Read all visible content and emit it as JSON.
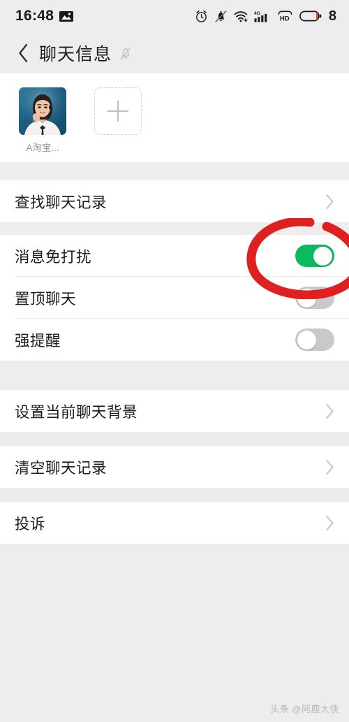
{
  "statusbar": {
    "time": "16:48",
    "left_icons": [
      "photo-icon"
    ],
    "right_icons": [
      "alarm-icon",
      "bell-muted-icon",
      "wifi-icon",
      "signal-4g-icon",
      "hd-icon",
      "battery-icon"
    ],
    "battery_level": "8"
  },
  "navbar": {
    "back_icon": "chevron-left-icon",
    "title": "聊天信息",
    "mute_icon": "bell-muted-icon"
  },
  "members": {
    "list": [
      {
        "name": "A淘宝...",
        "avatar": "customer-service-woman-photo"
      }
    ],
    "add_label": "+"
  },
  "sections": [
    {
      "rows": [
        {
          "label": "查找聊天记录",
          "type": "link",
          "accessory": "chevron-right-icon"
        }
      ]
    },
    {
      "rows": [
        {
          "label": "消息免打扰",
          "type": "toggle",
          "value": "on",
          "annotated": "true"
        },
        {
          "label": "置顶聊天",
          "type": "toggle",
          "value": "off"
        },
        {
          "label": "强提醒",
          "type": "toggle",
          "value": "off"
        }
      ]
    },
    {
      "rows": [
        {
          "label": "设置当前聊天背景",
          "type": "link",
          "accessory": "chevron-right-icon"
        }
      ]
    },
    {
      "rows": [
        {
          "label": "清空聊天记录",
          "type": "link",
          "accessory": "chevron-right-icon"
        }
      ]
    },
    {
      "rows": [
        {
          "label": "投诉",
          "type": "link",
          "accessory": "chevron-right-icon"
        }
      ]
    }
  ],
  "annotation": {
    "shape": "hand-drawn-red-ellipse",
    "color": "#e02020",
    "targets": "消息免打扰"
  },
  "watermark": {
    "text": "头条 @阿鹿大侠"
  },
  "colors": {
    "toggle_on": "#0aba5c",
    "toggle_off": "#c9c9c9",
    "page_bg": "#ededed",
    "card_bg": "#ffffff",
    "annotation_red": "#e02020"
  }
}
